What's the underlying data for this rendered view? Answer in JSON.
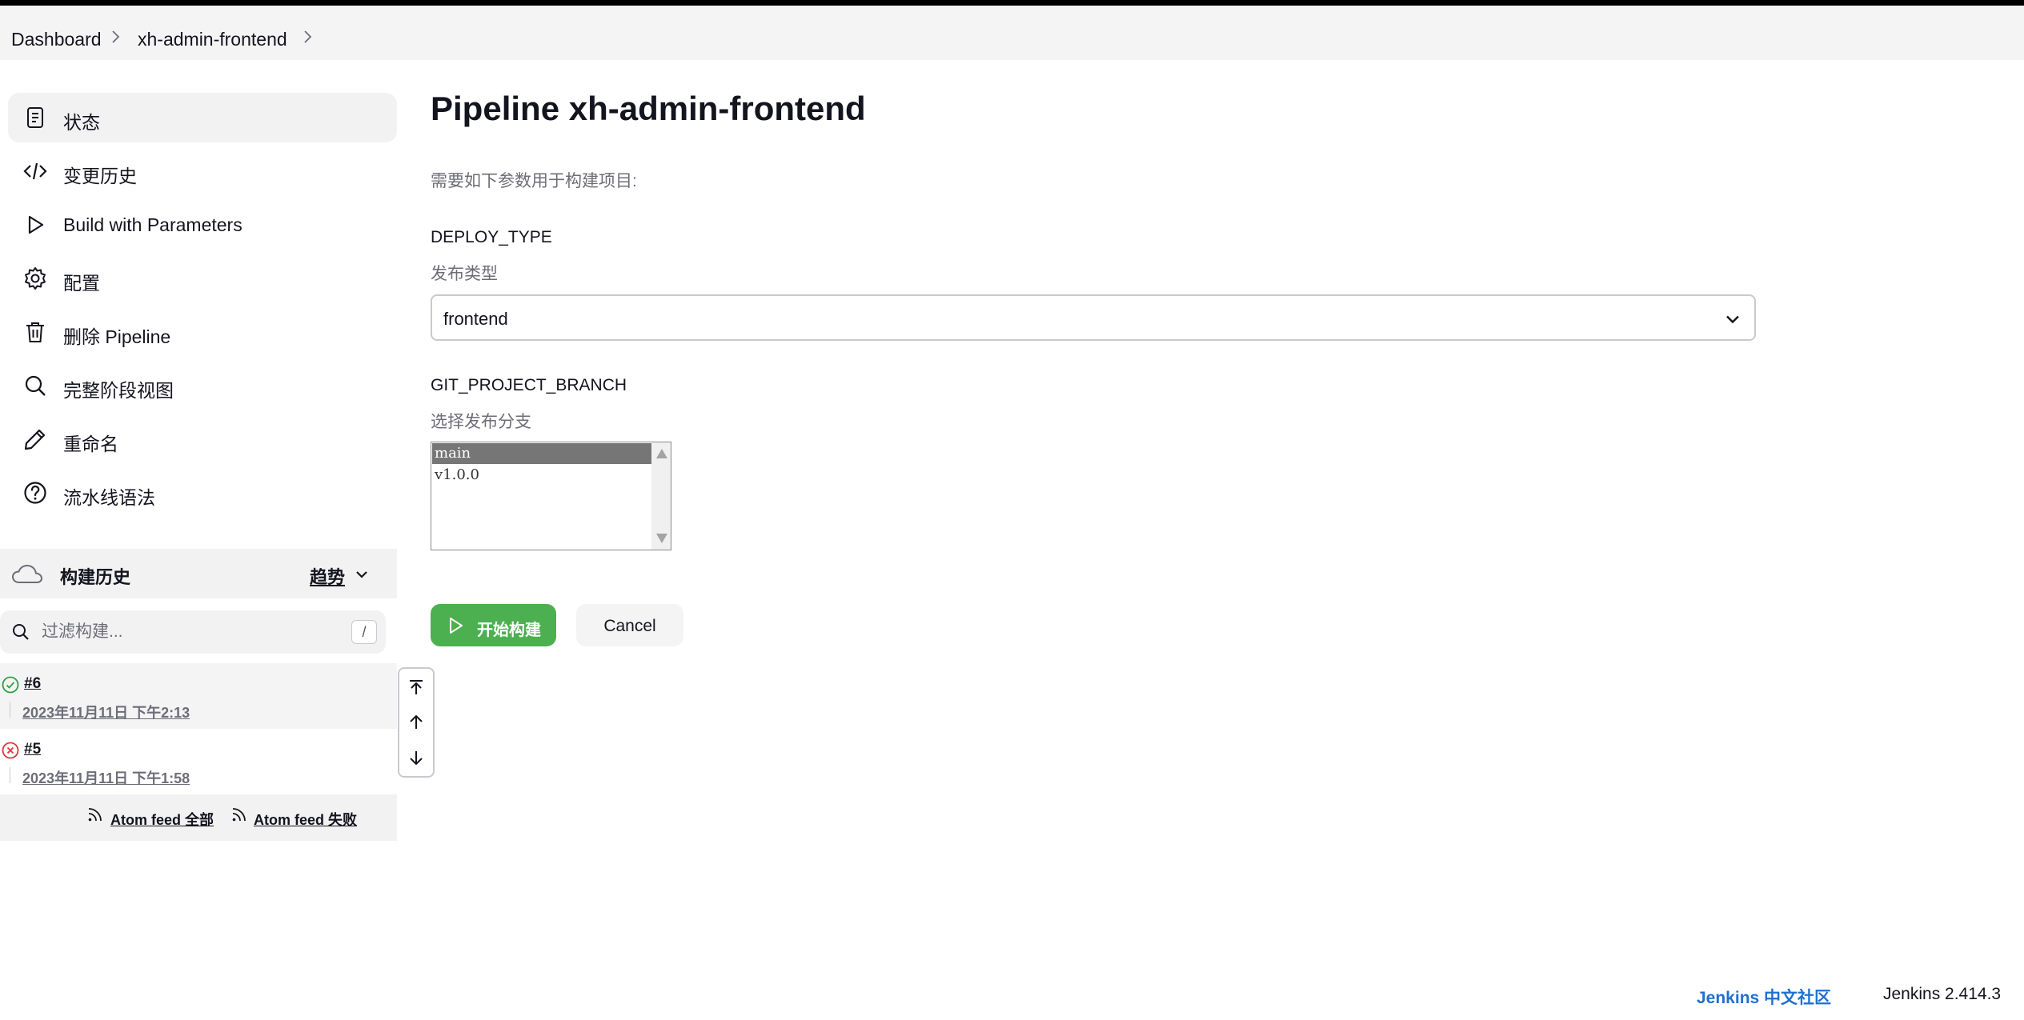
{
  "breadcrumb": {
    "items": [
      "Dashboard",
      "xh-admin-frontend"
    ]
  },
  "sidebar": {
    "items": [
      {
        "label": "状态",
        "icon": "status-document-icon",
        "active": true
      },
      {
        "label": "变更历史",
        "icon": "code-icon"
      },
      {
        "label": "Build with Parameters",
        "icon": "play-icon"
      },
      {
        "label": "配置",
        "icon": "gear-icon"
      },
      {
        "label": "删除 Pipeline",
        "icon": "trash-icon"
      },
      {
        "label": "完整阶段视图",
        "icon": "search-icon"
      },
      {
        "label": "重命名",
        "icon": "pencil-icon"
      },
      {
        "label": "流水线语法",
        "icon": "help-icon"
      }
    ]
  },
  "build_history": {
    "title": "构建历史",
    "trend_label": "趋势",
    "filter_placeholder": "过滤构建...",
    "filter_shortcut": "/",
    "builds": [
      {
        "number": "#6",
        "date": "2023年11月11日 下午2:13",
        "status": "success"
      },
      {
        "number": "#5",
        "date": "2023年11月11日 下午1:58",
        "status": "failed"
      }
    ],
    "feeds": {
      "all": "Atom feed 全部",
      "failed": "Atom feed 失败"
    }
  },
  "main": {
    "title": "Pipeline xh-admin-frontend",
    "description": "需要如下参数用于构建项目:",
    "params": [
      {
        "name": "DEPLOY_TYPE",
        "desc": "发布类型",
        "value": "frontend"
      },
      {
        "name": "GIT_PROJECT_BRANCH",
        "desc": "选择发布分支",
        "options": [
          "main",
          "v1.0.0"
        ],
        "selected": "main"
      }
    ],
    "build_button": "开始构建",
    "cancel_button": "Cancel"
  },
  "footer": {
    "community_link": "Jenkins 中文社区",
    "version": "Jenkins 2.414.3"
  },
  "colors": {
    "accent_green": "#4caf50",
    "link_blue": "#1f6fd0",
    "success": "#2f9e44",
    "failure": "#d9363e"
  }
}
